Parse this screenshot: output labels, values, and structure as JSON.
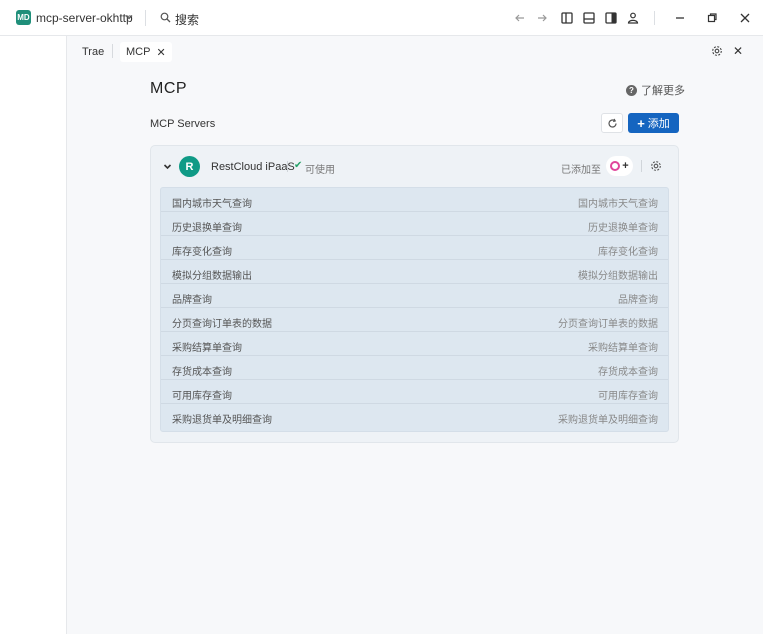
{
  "titlebar": {
    "project_badge": "MD",
    "project_name": "mcp-server-okhttp",
    "search_label": "搜索"
  },
  "tabs": [
    {
      "label": "Trae",
      "active": false
    },
    {
      "label": "MCP",
      "active": true,
      "close": "✕"
    }
  ],
  "page": {
    "title": "MCP",
    "learn_more": "了解更多",
    "servers_label": "MCP Servers",
    "add_button": "添加"
  },
  "server": {
    "avatar_letter": "R",
    "name": "RestCloud iPaaS",
    "status": "可使用",
    "added_to": "已添加至",
    "accent": "#0f9a86",
    "tools": [
      {
        "name": "国内城市天气查询",
        "desc": "国内城市天气查询"
      },
      {
        "name": "历史退换单查询",
        "desc": "历史退换单查询"
      },
      {
        "name": "库存变化查询",
        "desc": "库存变化查询"
      },
      {
        "name": "模拟分组数据输出",
        "desc": "模拟分组数据输出"
      },
      {
        "name": "品牌查询",
        "desc": "品牌查询"
      },
      {
        "name": "分页查询订单表的数据",
        "desc": "分页查询订单表的数据"
      },
      {
        "name": "采购结算单查询",
        "desc": "采购结算单查询"
      },
      {
        "name": "存货成本查询",
        "desc": "存货成本查询"
      },
      {
        "name": "可用库存查询",
        "desc": "可用库存查询"
      },
      {
        "name": "采购退货单及明细查询",
        "desc": "采购退货单及明细查询"
      }
    ]
  },
  "colors": {
    "primary": "#1565c0",
    "status_ok": "#26a269"
  }
}
